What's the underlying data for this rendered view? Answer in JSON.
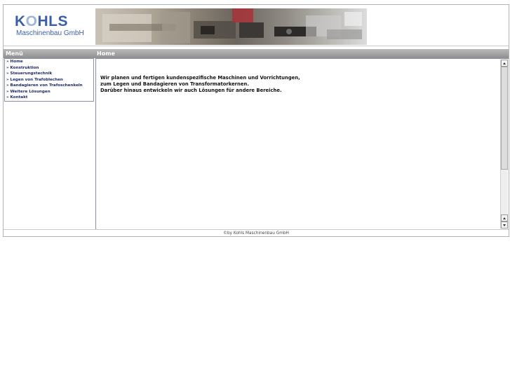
{
  "header": {
    "logo_main": "KOHLS",
    "logo_sub": "Maschinenbau GmbH"
  },
  "menu": {
    "title": "Menü",
    "items": [
      {
        "label": "» Home"
      },
      {
        "label": "» Konstruktion"
      },
      {
        "label": "» Steuerungstechnik"
      },
      {
        "label": "» Legen von Trafoblechen"
      },
      {
        "label": "» Bandagieren von Trafoschenkeln"
      },
      {
        "label": "» Weitere Lösungen"
      },
      {
        "label": "» Kontakt"
      }
    ]
  },
  "content": {
    "title": "Home",
    "lines": [
      "Wir planen und fertigen kundenspezifische Maschinen und Vorrichtungen,",
      "zum Legen und Bandagieren von Transformatorkernen.",
      "Darüber hinaus entwickeln wir auch Lösungen für andere Bereiche."
    ]
  },
  "footer": {
    "text": "©by Kohls Maschinenbau GmbH"
  },
  "colors": {
    "brand": "#3a5fa8",
    "menu_text": "#1c2a66",
    "header_bar": "#9f9f9f"
  }
}
